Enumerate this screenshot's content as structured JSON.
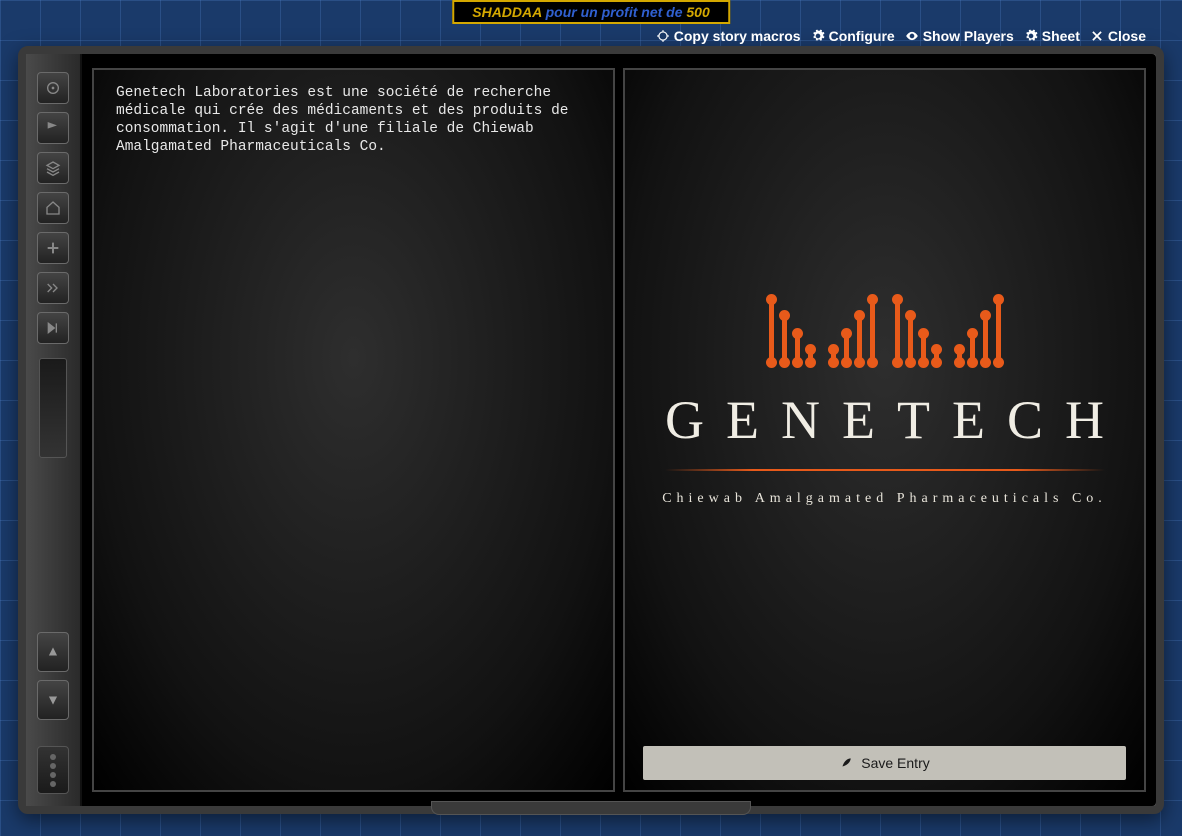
{
  "banner": {
    "text_left": "SHADDAA",
    "text_mid": "pour un profit net de",
    "text_right": "500"
  },
  "toolbar": {
    "copy_macros": "Copy story macros",
    "configure": "Configure",
    "show_players": "Show Players",
    "sheet": "Sheet",
    "close": "Close"
  },
  "sidebar_icons": [
    "target-icon",
    "flag-icon",
    "layers-icon",
    "home-icon",
    "plus-icon",
    "forward-icon",
    "skip-icon"
  ],
  "entry": {
    "description": "Genetech Laboratories est une société de recherche médicale qui crée des médicaments et des produits de consommation. Il s'agit d'une filiale de Chiewab Amalgamated Pharmaceuticals Co."
  },
  "logo": {
    "name": "GENETECH",
    "subtitle": "Chiewab Amalgamated Pharmaceuticals Co.",
    "accent_color": "#e85a1a"
  },
  "actions": {
    "save": "Save Entry"
  }
}
